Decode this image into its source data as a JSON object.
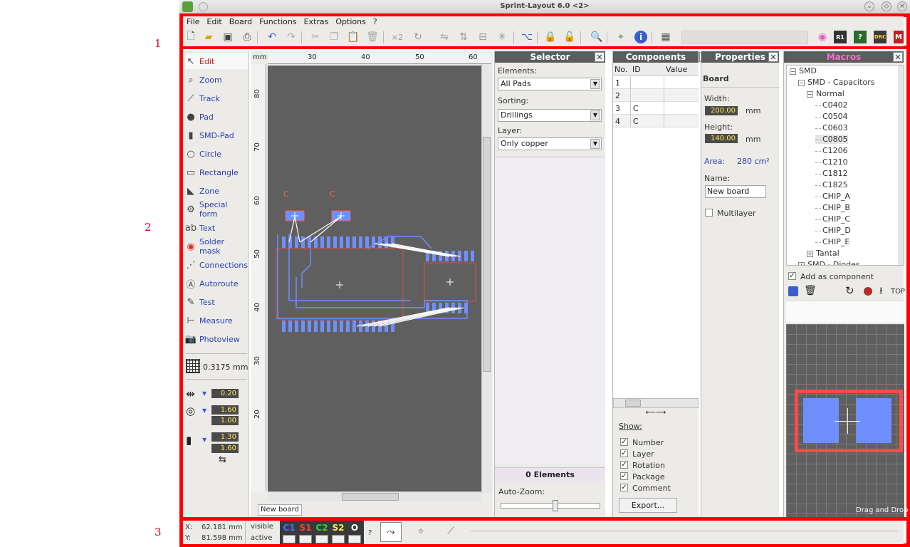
{
  "window": {
    "title": "Sprint-Layout 6.0 <2>"
  },
  "annotations": [
    "1",
    "2",
    "3"
  ],
  "menu": [
    "File",
    "Edit",
    "Board",
    "Functions",
    "Extras",
    "Options",
    "?"
  ],
  "toolbar": {
    "badges": [
      "R1",
      "DRC"
    ]
  },
  "tools": [
    {
      "label": "Edit",
      "icon": "cursor-icon"
    },
    {
      "label": "Zoom",
      "icon": "magnifier-icon"
    },
    {
      "label": "Track",
      "icon": "track-icon"
    },
    {
      "label": "Pad",
      "icon": "pad-icon"
    },
    {
      "label": "SMD-Pad",
      "icon": "smd-pad-icon"
    },
    {
      "label": "Circle",
      "icon": "circle-icon"
    },
    {
      "label": "Rectangle",
      "icon": "rectangle-icon"
    },
    {
      "label": "Zone",
      "icon": "zone-icon"
    },
    {
      "label": "Special form",
      "icon": "special-form-icon"
    },
    {
      "label": "Text",
      "icon": "text-icon"
    },
    {
      "label": "Solder mask",
      "icon": "solder-mask-icon"
    },
    {
      "label": "Connections",
      "icon": "connections-icon"
    },
    {
      "label": "Autoroute",
      "icon": "autoroute-icon"
    },
    {
      "label": "Test",
      "icon": "test-icon"
    },
    {
      "label": "Measure",
      "icon": "measure-icon"
    },
    {
      "label": "Photoview",
      "icon": "photoview-icon"
    }
  ],
  "grid": {
    "value": "0.3175 mm"
  },
  "params": {
    "track_width": "0.20",
    "pad_outer": "1.60",
    "pad_inner": "1.00",
    "smd_w": "1.30",
    "smd_h": "1.60"
  },
  "ruler": {
    "unit": "mm",
    "top": [
      "30",
      "40",
      "50",
      "60"
    ],
    "left": [
      "80",
      "70",
      "60",
      "50",
      "40",
      "30",
      "20"
    ]
  },
  "board": {
    "tab": "New board",
    "silk_labels": [
      "C",
      "C"
    ]
  },
  "selector": {
    "title": "Selector",
    "elements_label": "Elements:",
    "elements_value": "All Pads",
    "sorting_label": "Sorting:",
    "sorting_value": "Drillings",
    "layer_label": "Layer:",
    "layer_value": "Only copper",
    "count": "0 Elements",
    "autozoom_label": "Auto-Zoom:"
  },
  "components": {
    "title": "Components",
    "columns": [
      "No.",
      "ID",
      "Value"
    ],
    "rows": [
      [
        "1",
        "",
        ""
      ],
      [
        "2",
        "",
        ""
      ],
      [
        "3",
        "C",
        ""
      ],
      [
        "4",
        "C",
        ""
      ]
    ],
    "show_label": "Show:",
    "show": [
      {
        "label": "Number",
        "checked": true
      },
      {
        "label": "Layer",
        "checked": true
      },
      {
        "label": "Rotation",
        "checked": true
      },
      {
        "label": "Package",
        "checked": true
      },
      {
        "label": "Comment",
        "checked": true
      }
    ],
    "export_label": "Export..."
  },
  "properties": {
    "title": "Properties",
    "section": "Board",
    "width_label": "Width:",
    "width_value": "200.00",
    "width_unit": "mm",
    "height_label": "Height:",
    "height_value": "140.00",
    "height_unit": "mm",
    "area_label": "Area:",
    "area_value": "280 cm²",
    "name_label": "Name:",
    "name_value": "New board",
    "multilayer_label": "Multilayer"
  },
  "macros": {
    "title": "Macros",
    "tree": [
      {
        "label": "SMD",
        "level": 0,
        "expander": "−"
      },
      {
        "label": "SMD - Capacitors",
        "level": 1,
        "expander": "−"
      },
      {
        "label": "Normal",
        "level": 2,
        "expander": "−"
      },
      {
        "label": "C0402",
        "level": 3
      },
      {
        "label": "C0504",
        "level": 3
      },
      {
        "label": "C0603",
        "level": 3
      },
      {
        "label": "C0805",
        "level": 3,
        "selected": true
      },
      {
        "label": "C1206",
        "level": 3
      },
      {
        "label": "C1210",
        "level": 3
      },
      {
        "label": "C1812",
        "level": 3
      },
      {
        "label": "C1825",
        "level": 3
      },
      {
        "label": "CHIP_A",
        "level": 3
      },
      {
        "label": "CHIP_B",
        "level": 3
      },
      {
        "label": "CHIP_C",
        "level": 3
      },
      {
        "label": "CHIP_D",
        "level": 3
      },
      {
        "label": "CHIP_E",
        "level": 3
      },
      {
        "label": "Tantal",
        "level": 2,
        "expander": "+"
      },
      {
        "label": "SMD - Diodes",
        "level": 1,
        "expander": "+"
      }
    ],
    "add_as_component": "Add as component",
    "toolbar_text": "TOP",
    "preview_hint": "Drag and Drop"
  },
  "status": {
    "x_label": "X:",
    "x_value": "62.181 mm",
    "y_label": "Y:",
    "y_value": "81.598 mm",
    "visible_label": "visible",
    "active_label": "active",
    "layers": [
      {
        "name": "C1",
        "color": "#4a6cff"
      },
      {
        "name": "S1",
        "color": "#ff3a3a"
      },
      {
        "name": "C2",
        "color": "#3ccc3c"
      },
      {
        "name": "S2",
        "color": "#ffe94a"
      },
      {
        "name": "O",
        "color": "#ffffff"
      }
    ],
    "help": "?"
  }
}
